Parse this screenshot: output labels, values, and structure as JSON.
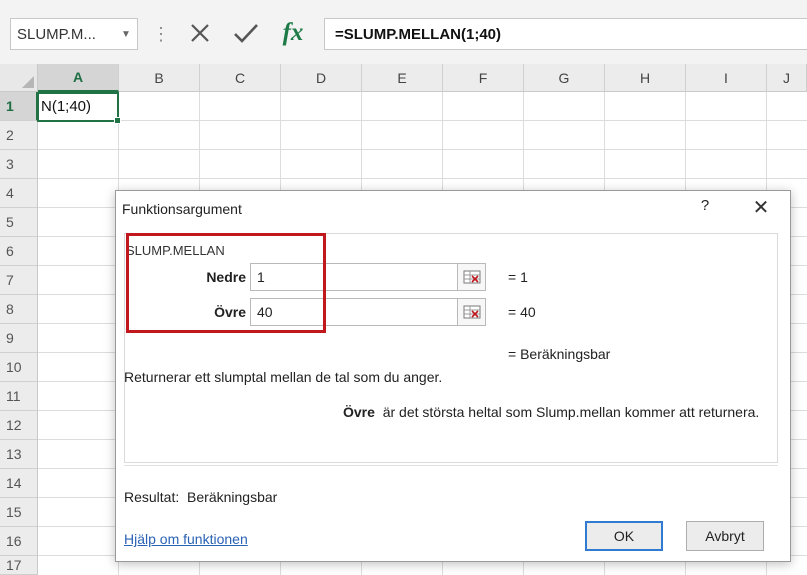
{
  "formula_bar": {
    "name_box": "SLUMP.M...",
    "formula": "=SLUMP.MELLAN(1;40)",
    "fx_label": "fx"
  },
  "grid": {
    "columns": [
      "A",
      "B",
      "C",
      "D",
      "E",
      "F",
      "G",
      "H",
      "I",
      "J"
    ],
    "rows": [
      "1",
      "2",
      "3",
      "4",
      "5",
      "6",
      "7",
      "8",
      "9",
      "10",
      "11",
      "12",
      "13",
      "14",
      "15",
      "16",
      "17"
    ],
    "active_cell_text": "N(1;40)"
  },
  "dialog": {
    "title": "Funktionsargument",
    "help": "?",
    "close": "✕",
    "function_name": "SLUMP.MELLAN",
    "args": [
      {
        "label": "Nedre",
        "value": "1",
        "result": "=  1"
      },
      {
        "label": "Övre",
        "value": "40",
        "result": "=  40"
      }
    ],
    "formula_result": "=  Beräkningsbar",
    "description": "Returnerar ett slumptal mellan de tal som du anger.",
    "arg_desc_name": "Övre",
    "arg_desc_text": "är det största heltal som Slump.mellan kommer att returnera.",
    "result_label": "Resultat:",
    "result_value": "Beräkningsbar",
    "help_link": "Hjälp om funktionen",
    "ok": "OK",
    "cancel": "Avbryt"
  },
  "colors": {
    "excel_green": "#217346",
    "highlight_red": "#c0181d",
    "link_blue": "#2a62b5"
  }
}
